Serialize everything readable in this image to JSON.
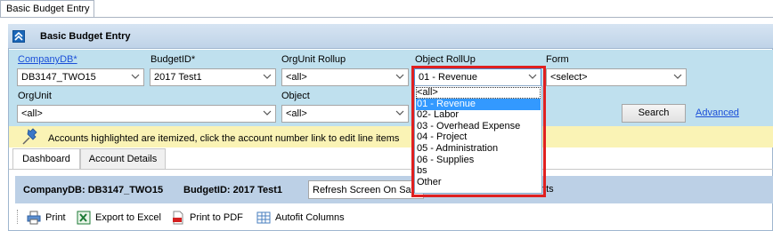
{
  "doc_tab": {
    "label": "Basic Budget Entry"
  },
  "panel": {
    "title": "Basic Budget Entry"
  },
  "filters": {
    "company_db": {
      "label": "CompanyDB*",
      "value": "DB3147_TWO15"
    },
    "budget_id": {
      "label": "BudgetID*",
      "value": "2017 Test1"
    },
    "orgunit_rollup": {
      "label": "OrgUnit Rollup",
      "value": "<all>"
    },
    "object_rollup": {
      "label": "Object RollUp",
      "value": "01 - Revenue"
    },
    "form": {
      "label": "Form",
      "value": "<select>"
    },
    "orgunit": {
      "label": "OrgUnit",
      "value": "<all>"
    },
    "object": {
      "label": "Object",
      "value": "<all>"
    }
  },
  "buttons": {
    "search": "Search",
    "advanced": "Advanced"
  },
  "notice": {
    "text": "Accounts highlighted are itemized, click the account number link to edit line items"
  },
  "tabs": [
    {
      "label": "Dashboard",
      "active": true
    },
    {
      "label": "Account Details",
      "active": false
    }
  ],
  "info_bar": {
    "company": "CompanyDB: DB3147_TWO15",
    "budget": "BudgetID: 2017 Test1",
    "refresh": "Refresh Screen On Save",
    "trailing": "nts"
  },
  "toolbar": {
    "print": "Print",
    "export": "Export to Excel",
    "pdf": "Print to PDF",
    "autofit": "Autofit Columns"
  },
  "object_rollup_options": [
    "<all>",
    "01 - Revenue",
    "02- Labor",
    "03 - Overhead Expense",
    "04 - Project",
    "05 - Administration",
    "06 - Supplies",
    "bs",
    "Other"
  ],
  "selected_option_index": 1,
  "colors": {
    "highlight_border": "#e02020",
    "selected_option": "#3399ff",
    "link": "#1b4fd8"
  }
}
